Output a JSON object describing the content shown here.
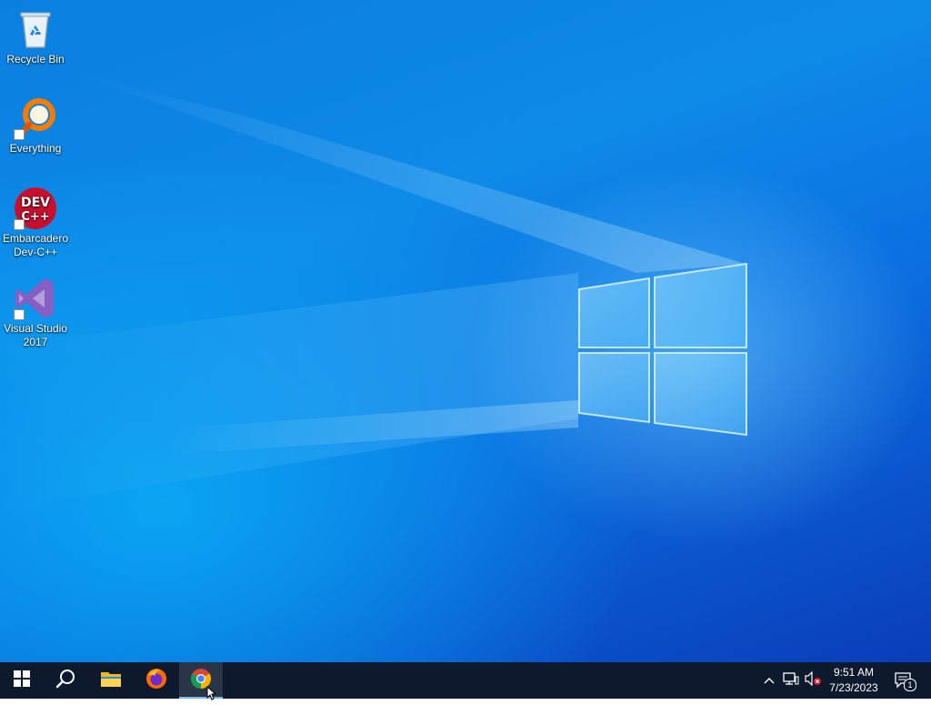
{
  "desktop": {
    "icons": [
      {
        "label": "Recycle Bin",
        "icon": "recycle-bin-icon"
      },
      {
        "label": "Everything",
        "icon": "everything-search-icon"
      },
      {
        "label": "Embarcadero Dev-C++",
        "icon": "devcpp-icon",
        "badge_text": "DEV C++"
      },
      {
        "label": "Visual Studio 2017",
        "icon": "visual-studio-icon"
      }
    ]
  },
  "taskbar": {
    "pinned": [
      {
        "name": "Start",
        "icon": "windows-start-icon"
      },
      {
        "name": "Search",
        "icon": "search-icon"
      },
      {
        "name": "File Explorer",
        "icon": "folder-icon"
      },
      {
        "name": "Firefox",
        "icon": "firefox-icon"
      },
      {
        "name": "Google Chrome",
        "icon": "chrome-icon",
        "active": true
      }
    ],
    "tray": {
      "icons": [
        "chevron-up-icon",
        "network-icon",
        "volume-muted-icon"
      ],
      "time": "9:51 AM",
      "date": "7/23/2023",
      "notification_count": "1"
    }
  },
  "colors": {
    "taskbar_bg": "#0d1a2e",
    "desktop_blue": "#0a7fe0",
    "active_underline": "#76b9ed",
    "chrome_red": "#db4437",
    "chrome_green": "#0f9d58",
    "chrome_yellow": "#f4b400",
    "chrome_blue": "#4285f4",
    "everything_orange": "#f57c00",
    "devcpp_red": "#c8102e",
    "vs_purple": "#865fc5"
  }
}
